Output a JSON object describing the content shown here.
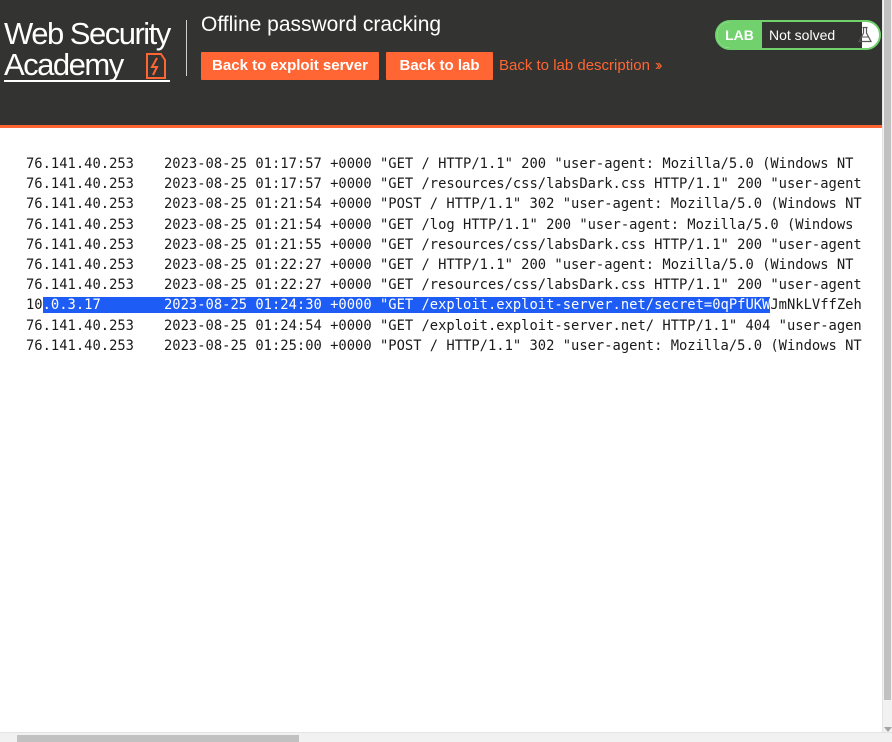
{
  "header": {
    "logo_line1": "Web Security",
    "logo_line2": "Academy",
    "lab_title": "Offline password cracking",
    "back_exploit_label": "Back to exploit server",
    "back_lab_label": "Back to lab",
    "description_link": "Back to lab description",
    "status_pill": "LAB",
    "status_text": "Not solved"
  },
  "log": [
    {
      "ip": "76.141.40.253",
      "entry": "2023-08-25 01:17:57 +0000 \"GET / HTTP/1.1\" 200 \"user-agent: Mozilla/5.0 (Windows NT"
    },
    {
      "ip": "76.141.40.253",
      "entry": "2023-08-25 01:17:57 +0000 \"GET /resources/css/labsDark.css HTTP/1.1\" 200 \"user-agent"
    },
    {
      "ip": "76.141.40.253",
      "entry": "2023-08-25 01:21:54 +0000 \"POST / HTTP/1.1\" 302 \"user-agent: Mozilla/5.0 (Windows NT"
    },
    {
      "ip": "76.141.40.253",
      "entry": "2023-08-25 01:21:54 +0000 \"GET /log HTTP/1.1\" 200 \"user-agent: Mozilla/5.0 (Windows"
    },
    {
      "ip": "76.141.40.253",
      "entry": "2023-08-25 01:21:55 +0000 \"GET /resources/css/labsDark.css HTTP/1.1\" 200 \"user-agent"
    },
    {
      "ip": "76.141.40.253",
      "entry": "2023-08-25 01:22:27 +0000 \"GET / HTTP/1.1\" 200 \"user-agent: Mozilla/5.0 (Windows NT"
    },
    {
      "ip": "76.141.40.253",
      "entry": "2023-08-25 01:22:27 +0000 \"GET /resources/css/labsDark.css HTTP/1.1\" 200 \"user-agent"
    },
    {
      "ip": "10.0.3.17",
      "entry": "2023-08-25 01:24:30 +0000 \"GET /exploit.exploit-server.net/secret=0qPfUKWJmNkLVffZeh"
    },
    {
      "ip": "76.141.40.253",
      "entry": "2023-08-25 01:24:54 +0000 \"GET /exploit.exploit-server.net/ HTTP/1.1\" 404 \"user-agen"
    },
    {
      "ip": "76.141.40.253",
      "entry": "2023-08-25 01:25:00 +0000 \"POST / HTTP/1.1\" 302 \"user-agent: Mozilla/5.0 (Windows NT"
    }
  ],
  "selected_line": {
    "ip_before": "10",
    "ip_selected": ".0.3.17",
    "entry_selected": "2023-08-25 01:24:30 +0000 \"GET /exploit.exploit-server.net/secret=0qPfUKW",
    "entry_after": "JmNkLVffZeh"
  },
  "colors": {
    "header_bg": "#333332",
    "accent": "#ff6633",
    "status_green": "#70d16d",
    "selection": "#1d5cf5"
  },
  "icons": {
    "logo_mark": "lightning-bolt-icon",
    "status_flask": "flask-icon",
    "description_chevron": "double-chevron-right-icon"
  }
}
